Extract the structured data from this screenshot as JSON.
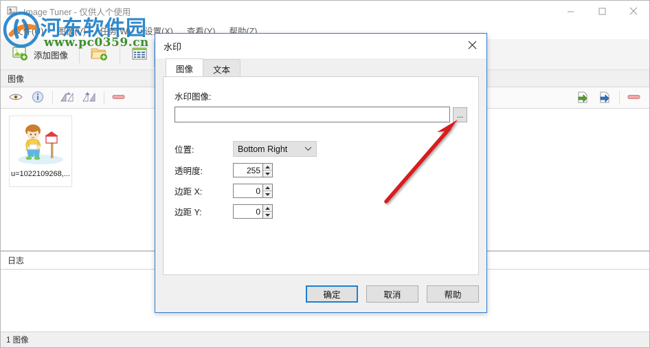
{
  "app": {
    "title": "Image Tuner - 仅供人个使用",
    "window_controls": {
      "minimize": "minimize-icon",
      "maximize": "maximize-icon",
      "close": "close-icon"
    }
  },
  "menubar": {
    "items": [
      {
        "label": "文件(U)"
      },
      {
        "label": "图像(V)"
      },
      {
        "label": "任务(W)"
      },
      {
        "label": "设置(X)"
      },
      {
        "label": "查看(Y)"
      },
      {
        "label": "帮助(Z)"
      }
    ]
  },
  "toolbar": {
    "add_image_label": "添加图像",
    "add_image_icon": "add-image-icon",
    "add_folder_icon": "add-folder-icon",
    "list_view_icon": "list-view-icon",
    "grid_view_icon": "grid-view-icon"
  },
  "images_section": {
    "header": "图像",
    "icon_toolbar": [
      {
        "name": "preview-eye-icon"
      },
      {
        "name": "info-icon"
      },
      {
        "name": "rotate-left-icon"
      },
      {
        "name": "rotate-right-icon"
      },
      {
        "name": "remove-icon"
      }
    ],
    "right_icon_toolbar": [
      {
        "name": "import-list-icon"
      },
      {
        "name": "export-list-icon"
      },
      {
        "name": "clear-list-icon"
      }
    ],
    "thumbnails": [
      {
        "caption": "u=1022109268,..."
      }
    ]
  },
  "log_section": {
    "header": "日志",
    "content": ""
  },
  "statusbar": {
    "text": "1 图像"
  },
  "site_watermark": {
    "name_cn": "河东软件园",
    "url": "www.pc0359.cn",
    "logo": "pc0359-logo"
  },
  "dialog": {
    "title": "水印",
    "close_icon": "close-icon",
    "tabs": [
      {
        "label": "图像",
        "active": true
      },
      {
        "label": "文本",
        "active": false
      }
    ],
    "fields": {
      "watermark_image_label": "水印图像:",
      "watermark_image_value": "",
      "watermark_image_placeholder": "",
      "browse_label": "...",
      "position_label": "位置:",
      "position_value": "Bottom Right",
      "opacity_label": "透明度:",
      "opacity_value": "255",
      "margin_x_label": "边距 X:",
      "margin_x_value": "0",
      "margin_y_label": "边距 Y:",
      "margin_y_value": "0"
    },
    "buttons": {
      "ok": "确定",
      "cancel": "取消",
      "help": "帮助"
    }
  },
  "annotation": {
    "type": "red-arrow",
    "color": "#d81f1f",
    "points_to": "browse-button"
  },
  "colors": {
    "accent": "#2d7dd2",
    "watermark_blue": "#1f7fc8",
    "watermark_green": "#3f8f2f",
    "annotation_red": "#d81f1f"
  }
}
